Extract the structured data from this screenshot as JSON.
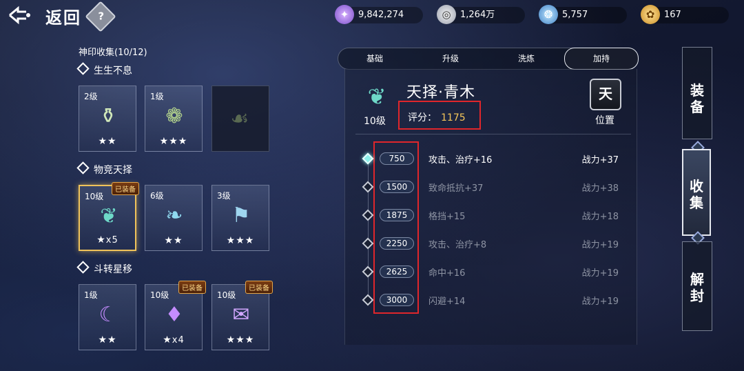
{
  "header": {
    "back_label": "返回",
    "help_label": "?"
  },
  "resources": [
    {
      "icon": "gem-icon",
      "value": "9,842,274"
    },
    {
      "icon": "coin-icon",
      "value": "1,264万"
    },
    {
      "icon": "spirit-icon",
      "value": "5,757"
    },
    {
      "icon": "gold-icon",
      "value": "167"
    }
  ],
  "collection": {
    "title": "神印收集(10/12)",
    "groups": [
      {
        "name": "生生不息",
        "cards": [
          {
            "level": "2级",
            "stars": "★★",
            "count": ""
          },
          {
            "level": "1级",
            "stars": "★★★",
            "count": ""
          },
          {
            "level": "",
            "stars": "",
            "count": ""
          }
        ]
      },
      {
        "name": "物竞天择",
        "cards": [
          {
            "level": "10级",
            "stars": "★",
            "count": "x5",
            "badge": "已装备"
          },
          {
            "level": "6级",
            "stars": "★★",
            "count": ""
          },
          {
            "level": "3级",
            "stars": "★★★",
            "count": ""
          }
        ]
      },
      {
        "name": "斗转星移",
        "cards": [
          {
            "level": "1级",
            "stars": "★★",
            "count": ""
          },
          {
            "level": "10级",
            "stars": "★",
            "count": "x4",
            "badge": "已装备"
          },
          {
            "level": "10级",
            "stars": "★★★",
            "count": "",
            "badge": "已装备"
          }
        ]
      }
    ]
  },
  "tabs": [
    "基础",
    "升级",
    "洗炼",
    "加持"
  ],
  "active_tab": "加持",
  "detail": {
    "name": "天择·青木",
    "score_label": "评分：",
    "score_value": "1175",
    "level": "10级",
    "position_char": "天",
    "position_label": "位置"
  },
  "bonuses": [
    {
      "threshold": "750",
      "attr": "攻击、治疗+16",
      "power": "战力+37",
      "active": true
    },
    {
      "threshold": "1500",
      "attr": "致命抵抗+37",
      "power": "战力+38",
      "active": false
    },
    {
      "threshold": "1875",
      "attr": "格挡+15",
      "power": "战力+18",
      "active": false
    },
    {
      "threshold": "2250",
      "attr": "攻击、治疗+8",
      "power": "战力+19",
      "active": false
    },
    {
      "threshold": "2625",
      "attr": "命中+16",
      "power": "战力+19",
      "active": false
    },
    {
      "threshold": "3000",
      "attr": "闪避+14",
      "power": "战力+19",
      "active": false
    }
  ],
  "side_tabs": [
    {
      "label_1": "装",
      "label_2": "备"
    },
    {
      "label_1": "收",
      "label_2": "集"
    },
    {
      "label_1": "解",
      "label_2": "封"
    }
  ],
  "colors": {
    "score": "#f5c65a",
    "highlight_box": "#e0262b",
    "selected_card": "#f0c35a"
  }
}
